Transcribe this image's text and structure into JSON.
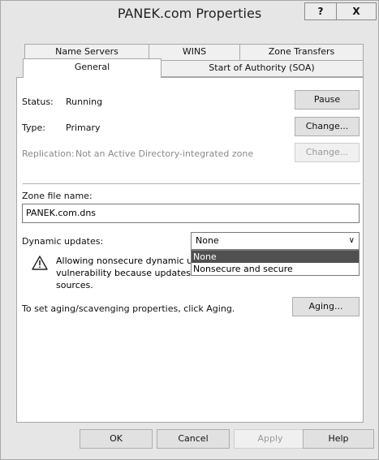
{
  "window": {
    "title": "PANEK.com Properties",
    "help_button": "?",
    "close_button": "X"
  },
  "tabs": {
    "row1": [
      "Name Servers",
      "WINS",
      "Zone Transfers"
    ],
    "row2": [
      "General",
      "Start of Authority (SOA)"
    ],
    "active": "General"
  },
  "general": {
    "status_label": "Status:",
    "status_value": "Running",
    "pause_button": "Pause",
    "type_label": "Type:",
    "type_value": "Primary",
    "type_change_button": "Change...",
    "replication_label": "Replication:",
    "replication_value": "Not an Active Directory-integrated zone",
    "replication_change_button": "Change...",
    "zone_file_label": "Zone file name:",
    "zone_file_value": "PANEK.com.dns",
    "dynamic_updates_label": "Dynamic updates:",
    "dynamic_updates_value": "None",
    "dynamic_updates_options": [
      "None",
      "Nonsecure and secure"
    ],
    "warning_lines": [
      "Allowing nonsecure dynamic u",
      "vulnerability because updates",
      "sources."
    ],
    "aging_text": "To set aging/scavenging properties, click Aging.",
    "aging_button": "Aging..."
  },
  "footer": {
    "ok": "OK",
    "cancel": "Cancel",
    "apply": "Apply",
    "help": "Help"
  }
}
